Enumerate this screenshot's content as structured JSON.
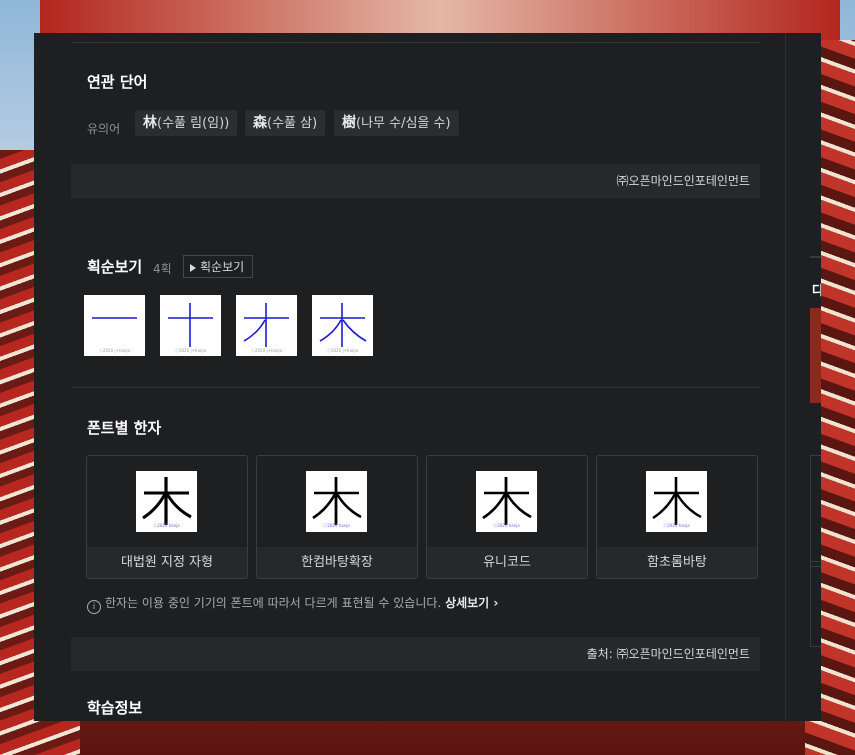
{
  "related_words": {
    "title": "연관 단어",
    "synonym_label": "유의어",
    "chips": [
      {
        "hanja": "林",
        "reading": "(수풀 림(임))"
      },
      {
        "hanja": "森",
        "reading": "(수풀 삼)"
      },
      {
        "hanja": "樹",
        "reading": "(나무 수/심을 수)"
      }
    ],
    "source": "㈜오픈마인드인포테인먼트"
  },
  "stroke_order": {
    "title": "획순보기",
    "count": "4획",
    "button_label": "획순보기",
    "watermark": "ⓒ2020 j+hanja"
  },
  "font_hanja": {
    "title": "폰트별 한자",
    "glyph": "木",
    "watermark": "ⓒ2020 hanja",
    "cards": [
      {
        "caption": "대법원 지정 자형"
      },
      {
        "caption": "한컴바탕확장"
      },
      {
        "caption": "유니코드"
      },
      {
        "caption": "함초롬바탕"
      }
    ],
    "notice_text": "한자는 이용 중인 기기의 폰트에 따라서 다르게 표현될 수 있습니다.",
    "notice_more": "상세보기",
    "source": "출처: ㈜오픈마인드인포테인먼트"
  },
  "learning": {
    "title": "학습정보"
  },
  "side_panel": {
    "label": "다"
  },
  "colors": {
    "modal_bg": "#1e1f21",
    "bar_bg": "#27282b",
    "stroke_blue": "#1a1ad6"
  }
}
